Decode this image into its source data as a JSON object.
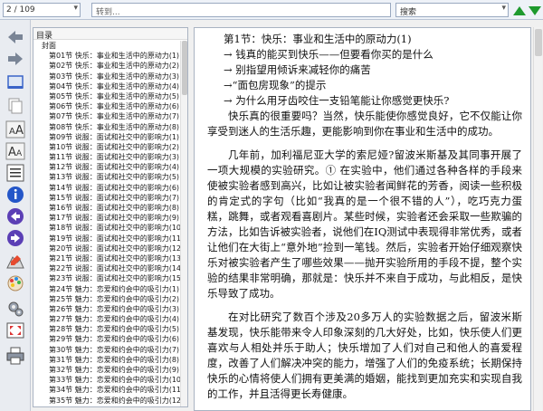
{
  "topbar": {
    "page_indicator": "2 / 109",
    "goto_placeholder": "转到...",
    "search_label": "搜索"
  },
  "toolbar": {
    "icons": [
      "arrow-left-icon",
      "arrow-right-icon",
      "single-page-icon",
      "copy-icon",
      "font-larger-icon",
      "font-smaller-icon",
      "list-view-icon",
      "info-icon",
      "back-circle-icon",
      "forward-circle-icon",
      "highlight-icon",
      "color-palette-icon",
      "settings-icon",
      "fullscreen-icon",
      "print-icon"
    ]
  },
  "toc": {
    "header": "目录",
    "items": [
      {
        "label": "封面",
        "root": true
      },
      {
        "label": "第01节 快乐：事业和生活中的原动力(1)"
      },
      {
        "label": "第02节 快乐：事业和生活中的原动力(2)"
      },
      {
        "label": "第03节 快乐：事业和生活中的原动力(3)"
      },
      {
        "label": "第04节 快乐：事业和生活中的原动力(4)"
      },
      {
        "label": "第05节 快乐：事业和生活中的原动力(5)"
      },
      {
        "label": "第06节 快乐：事业和生活中的原动力(6)"
      },
      {
        "label": "第07节 快乐：事业和生活中的原动力(7)"
      },
      {
        "label": "第08节 快乐：事业和生活中的原动力(8)"
      },
      {
        "label": "第09节 说服：面试和社交中的影响力(1)"
      },
      {
        "label": "第10节 说服：面试和社交中的影响力(2)"
      },
      {
        "label": "第11节 说服：面试和社交中的影响力(3)"
      },
      {
        "label": "第12节 说服：面试和社交中的影响力(4)"
      },
      {
        "label": "第13节 说服：面试和社交中的影响力(5)"
      },
      {
        "label": "第14节 说服：面试和社交中的影响力(6)"
      },
      {
        "label": "第15节 说服：面试和社交中的影响力(7)"
      },
      {
        "label": "第16节 说服：面试和社交中的影响力(8)"
      },
      {
        "label": "第17节 说服：面试和社交中的影响力(9)"
      },
      {
        "label": "第18节 说服：面试和社交中的影响力(10)"
      },
      {
        "label": "第19节 说服：面试和社交中的影响力(11)"
      },
      {
        "label": "第20节 说服：面试和社交中的影响力(12)"
      },
      {
        "label": "第21节 说服：面试和社交中的影响力(13)"
      },
      {
        "label": "第22节 说服：面试和社交中的影响力(14)"
      },
      {
        "label": "第23节 说服：面试和社交中的影响力(15)"
      },
      {
        "label": "第24节 魅力：恋爱和约会中的吸引力(1)"
      },
      {
        "label": "第25节 魅力：恋爱和约会中的吸引力(2)"
      },
      {
        "label": "第26节 魅力：恋爱和约会中的吸引力(3)"
      },
      {
        "label": "第27节 魅力：恋爱和约会中的吸引力(4)"
      },
      {
        "label": "第28节 魅力：恋爱和约会中的吸引力(5)"
      },
      {
        "label": "第29节 魅力：恋爱和约会中的吸引力(6)"
      },
      {
        "label": "第30节 魅力：恋爱和约会中的吸引力(7)"
      },
      {
        "label": "第31节 魅力：恋爱和约会中的吸引力(8)"
      },
      {
        "label": "第32节 魅力：恋爱和约会中的吸引力(9)"
      },
      {
        "label": "第33节 魅力：恋爱和约会中的吸引力(10)"
      },
      {
        "label": "第34节 魅力：恋爱和约会中的吸引力(11)"
      },
      {
        "label": "第35节 魅力：恋爱和约会中的吸引力(12)"
      }
    ]
  },
  "document": {
    "title": "第1节：快乐：事业和生活中的原动力(1)",
    "bullets": [
      "→ 钱真的能买到快乐——但要看你买的是什么",
      "→ 别指望用倾诉来减轻你的痛苦",
      "→“面包房现象”的提示",
      "→ 为什么用牙齿咬住一支铅笔能让你感觉更快乐?"
    ],
    "paragraphs": [
      "快乐真的很重要吗？当然，快乐能使你感觉良好，它不仅能让你享受到迷人的生活乐趣，更能影响到你在事业和生活中的成功。",
      "几年前，加利福尼亚大学的索尼娅?留波米斯基及其同事开展了一项大规模的实验研究。① 在实验中，他们通过各种各样的手段来使被实验者感到高兴，比如让被实验者闻鲜花的芳香，阅读一些积极的肯定式的字句（比如“我真的是一个很不错的人”），吃巧克力蛋糕，跳舞，或者观看喜剧片。某些时候，实验者还会采取一些欺骗的方法，比如告诉被实验者，说他们在IQ测试中表现得非常优秀，或者让他们在大街上“意外地”捡到一笔钱。然后，实验者开始仔细观察快乐对被实验者产生了哪些效果——抛开实验所用的手段不提，整个实验的结果非常明确，那就是：快乐并不来自于成功，与此相反，是快乐导致了成功。",
      "在对比研究了数百个涉及20多万人的实验数据之后，留波米斯基发现，快乐能带来令人印象深刻的几大好处，比如，快乐使人们更喜欢与人相处并乐于助人；快乐增加了人们对自己和他人的喜爱程度，改善了人们解决冲突的能力，增强了人们的免疫系统；长期保持快乐的心情将使人们拥有更美满的婚姻，能找到更加充实和实现自我的工作，并且活得更长寿健康。"
    ]
  },
  "colors": {
    "accent_blue": "#3a64c8",
    "nav_green": "#1e9a2e"
  }
}
